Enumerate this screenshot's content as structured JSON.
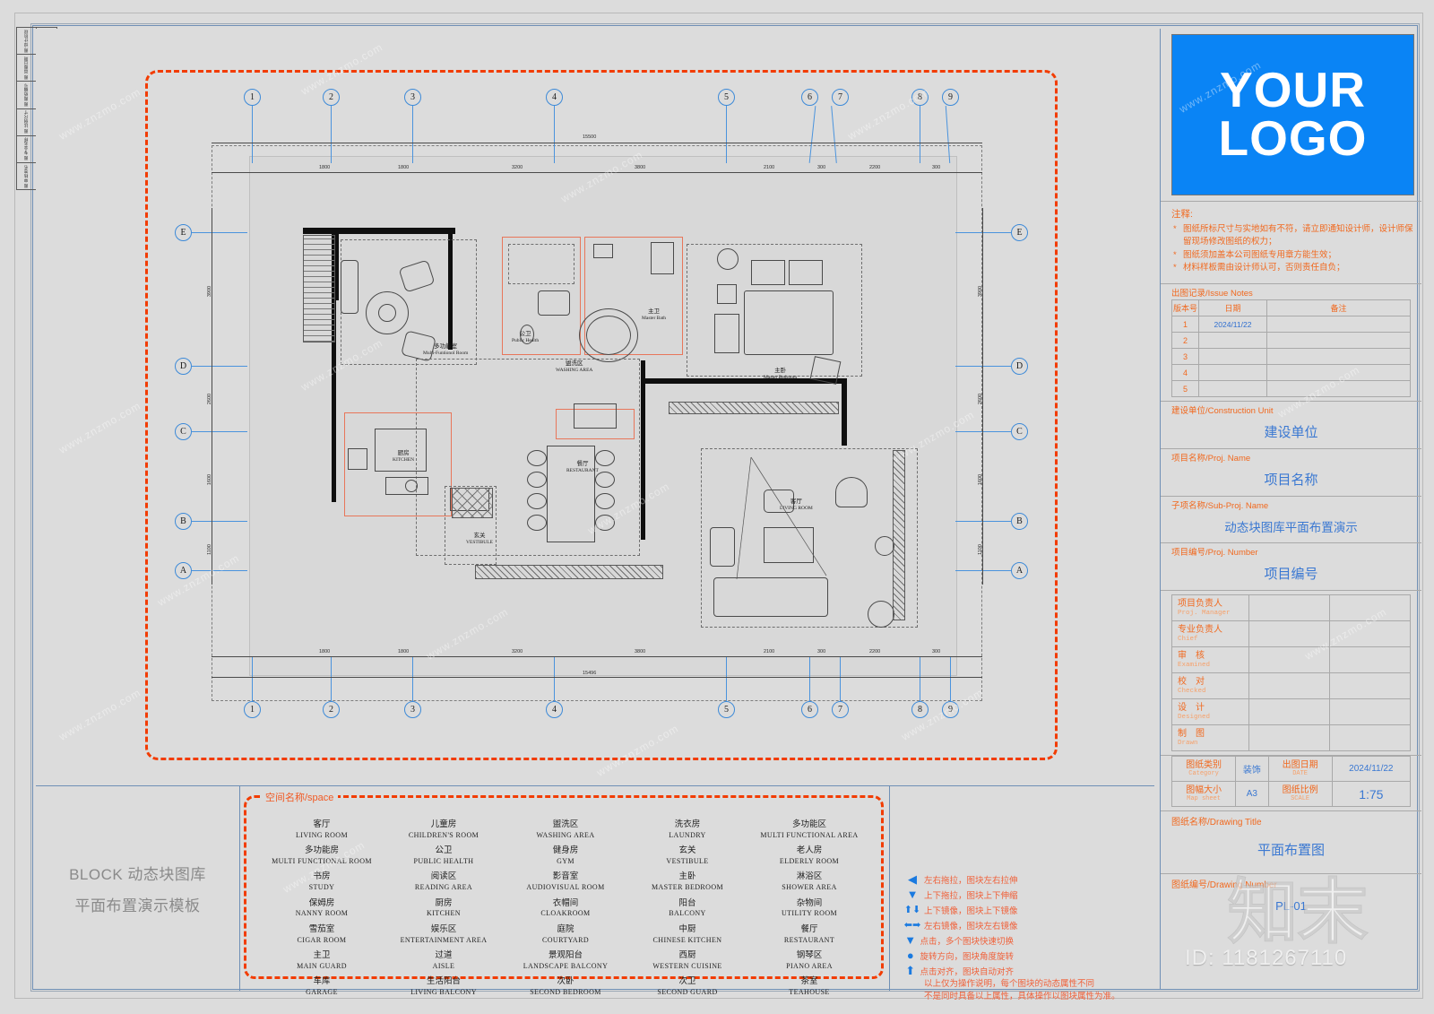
{
  "logo": {
    "line1": "YOUR",
    "line2": "LOGO"
  },
  "notes": {
    "heading": "注释:",
    "items": [
      "图纸所标尺寸与实地如有不符，请立即通知设计师，设计师保留现场修改图纸的权力；",
      "图纸须加盖本公司图纸专用章方能生效；",
      "材料样板需由设计师认可，否则责任自负；"
    ]
  },
  "issue_notes": {
    "label": "出图记录/Issue Notes",
    "headers": [
      "版本号",
      "日期",
      "备注"
    ],
    "rows": [
      {
        "version": "1",
        "date": "2024/11/22",
        "remark": ""
      },
      {
        "version": "2",
        "date": "",
        "remark": ""
      },
      {
        "version": "3",
        "date": "",
        "remark": ""
      },
      {
        "version": "4",
        "date": "",
        "remark": ""
      },
      {
        "version": "5",
        "date": "",
        "remark": ""
      }
    ]
  },
  "info_sections": [
    {
      "label": "建设单位/Construction Unit",
      "value": "建设单位"
    },
    {
      "label": "项目名称/Proj. Name",
      "value": "项目名称"
    },
    {
      "label": "子项名称/Sub-Proj. Name",
      "value": "动态块图库平面布置演示"
    },
    {
      "label": "项目编号/Proj. Number",
      "value": "项目编号"
    }
  ],
  "signatures": [
    {
      "cn": "项目负责人",
      "en": "Proj. Manager",
      "name": "",
      "sign": ""
    },
    {
      "cn": "专业负责人",
      "en": "Chief",
      "name": "",
      "sign": ""
    },
    {
      "cn": "审　核",
      "en": "Examined",
      "name": "",
      "sign": ""
    },
    {
      "cn": "校　对",
      "en": "Checked",
      "name": "",
      "sign": ""
    },
    {
      "cn": "设　计",
      "en": "Designed",
      "name": "",
      "sign": ""
    },
    {
      "cn": "制　图",
      "en": "Drawn",
      "name": "",
      "sign": ""
    }
  ],
  "meta": {
    "category_cn": "图纸类别",
    "category_en": "Category",
    "category_value": "装饰",
    "date_cn": "出图日期",
    "date_en": "DATE",
    "date_value": "2024/11/22",
    "sheet_cn": "图幅大小",
    "sheet_en": "Map sheet",
    "sheet_value": "A3",
    "scale_cn": "图纸比例",
    "scale_en": "SCALE",
    "scale_value": "1:75"
  },
  "drawing_title": {
    "label": "图纸名称/Drawing Title",
    "value": "平面布置图"
  },
  "drawing_number": {
    "label": "图纸编号/Drawing Number",
    "value": "PL-01"
  },
  "legend_left": {
    "line1": "BLOCK 动态块图库",
    "line2": "平面布置演示模板"
  },
  "space_legend": {
    "title": "空间名称/space",
    "items": [
      {
        "cn": "客厅",
        "en": "LIVING ROOM"
      },
      {
        "cn": "儿童房",
        "en": "CHILDREN'S ROOM"
      },
      {
        "cn": "盥洗区",
        "en": "WASHING AREA"
      },
      {
        "cn": "洗衣房",
        "en": "LAUNDRY"
      },
      {
        "cn": "多功能区",
        "en": "MULTI FUNCTIONAL AREA"
      },
      {
        "cn": "多功能房",
        "en": "MULTI FUNCTIONAL ROOM"
      },
      {
        "cn": "公卫",
        "en": "PUBLIC HEALTH"
      },
      {
        "cn": "健身房",
        "en": "GYM"
      },
      {
        "cn": "玄关",
        "en": "VESTIBULE"
      },
      {
        "cn": "老人房",
        "en": "ELDERLY ROOM"
      },
      {
        "cn": "书房",
        "en": "STUDY"
      },
      {
        "cn": "阅读区",
        "en": "READING AREA"
      },
      {
        "cn": "影音室",
        "en": "AUDIOVISUAL ROOM"
      },
      {
        "cn": "主卧",
        "en": "MASTER BEDROOM"
      },
      {
        "cn": "淋浴区",
        "en": "SHOWER AREA"
      },
      {
        "cn": "保姆房",
        "en": "NANNY ROOM"
      },
      {
        "cn": "厨房",
        "en": "KITCHEN"
      },
      {
        "cn": "衣帽间",
        "en": "CLOAKROOM"
      },
      {
        "cn": "阳台",
        "en": "BALCONY"
      },
      {
        "cn": "杂物间",
        "en": "UTILITY ROOM"
      },
      {
        "cn": "雪茄室",
        "en": "CIGAR ROOM"
      },
      {
        "cn": "娱乐区",
        "en": "ENTERTAINMENT AREA"
      },
      {
        "cn": "庭院",
        "en": "COURTYARD"
      },
      {
        "cn": "中厨",
        "en": "CHINESE KITCHEN"
      },
      {
        "cn": "餐厅",
        "en": "RESTAURANT"
      },
      {
        "cn": "主卫",
        "en": "MAIN GUARD"
      },
      {
        "cn": "过道",
        "en": "AISLE"
      },
      {
        "cn": "景观阳台",
        "en": "LANDSCAPE BALCONY"
      },
      {
        "cn": "西厨",
        "en": "WESTERN CUISINE"
      },
      {
        "cn": "钢琴区",
        "en": "PIANO AREA"
      },
      {
        "cn": "车库",
        "en": "GARAGE"
      },
      {
        "cn": "生活阳台",
        "en": "LIVING BALCONY"
      },
      {
        "cn": "次卧",
        "en": "SECOND BEDROOM"
      },
      {
        "cn": "次卫",
        "en": "SECOND GUARD"
      },
      {
        "cn": "茶室",
        "en": "TEAHOUSE"
      },
      {
        "cn": "",
        "en": ""
      },
      {
        "cn": "",
        "en": ""
      },
      {
        "cn": "",
        "en": ""
      },
      {
        "cn": "",
        "en": ""
      },
      {
        "cn": "",
        "en": ""
      }
    ]
  },
  "hints": {
    "column_left": [
      {
        "icon": "◀",
        "text": "左右拖拉，图块左右拉伸"
      },
      {
        "icon": "▼",
        "text": "上下拖拉，图块上下伸缩"
      },
      {
        "icon": "⬆⬇",
        "text": "上下镜像，图块上下镜像"
      },
      {
        "icon": "⬅➡",
        "text": "左右镜像，图块左右镜像"
      }
    ],
    "column_right": [
      {
        "icon": "▼",
        "text": "点击，多个图块快速切换"
      },
      {
        "icon": "●",
        "text": "旋转方向，图块角度旋转"
      },
      {
        "icon": "⬆",
        "text": "点击对齐，图块自动对齐"
      }
    ],
    "note_line1": "以上仅为操作说明，每个图块的动态属性不同",
    "note_line2": "不是同时具备以上属性，具体操作以图块属性为准。"
  },
  "grid": {
    "columns": [
      "1",
      "2",
      "3",
      "4",
      "5",
      "6",
      "7",
      "8",
      "9"
    ],
    "rows": [
      "A",
      "B",
      "C",
      "D",
      "E"
    ],
    "top_dimensions": [
      "1800",
      "1800",
      "3200",
      "3800",
      "2100",
      "300",
      "2200",
      "300"
    ],
    "total_dimension": "15500",
    "bottom_total": "15496",
    "left_dimensions": [
      "3900",
      "2600",
      "1600",
      "1100"
    ],
    "right_dimensions": [
      "3900",
      "2600",
      "1600",
      "1100"
    ]
  },
  "plan_labels": [
    {
      "cn": "多功能室",
      "en": "Multi-Funtionol Room"
    },
    {
      "cn": "公卫",
      "en": "Public Health"
    },
    {
      "cn": "主卫",
      "en": "Master Bath"
    },
    {
      "cn": "主卧",
      "en": "Master Bedroom"
    },
    {
      "cn": "盥洗区",
      "en": "WASHING AREA"
    },
    {
      "cn": "厨房",
      "en": "KITCHEN"
    },
    {
      "cn": "餐厅",
      "en": "RESTAURANT"
    },
    {
      "cn": "玄关",
      "en": "VESTIBULE"
    },
    {
      "cn": "客厅",
      "en": "LIVING ROOM"
    }
  ],
  "revision_strip": [
    "图 设计阶段",
    "图 出图日期",
    "图 图纸编号",
    "图 比例尺寸",
    "图 专业名称",
    "图 审核签名"
  ],
  "watermarks": {
    "domain": "www.znzmo.com",
    "brand": "知末",
    "id": "ID: 1181267110"
  },
  "colors": {
    "accent_orange": "#f1691f",
    "accent_blue": "#3a78d2",
    "logo_blue": "#0a84f5",
    "red_dash": "#f23c00"
  }
}
